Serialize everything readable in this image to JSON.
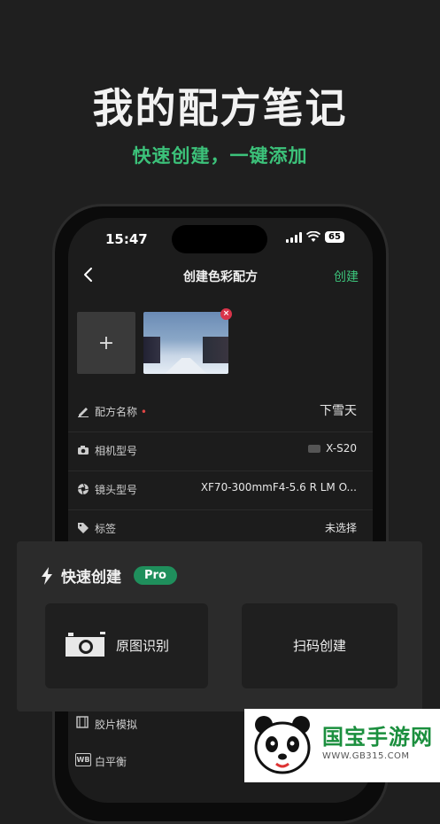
{
  "promo": {
    "headline": "我的配方笔记",
    "subline": "快速创建，一键添加"
  },
  "status_bar": {
    "time": "15:47",
    "battery": "65"
  },
  "nav": {
    "title": "创建色彩配方",
    "create_label": "创建"
  },
  "photos": {
    "add_symbol": "+",
    "remove_symbol": "×"
  },
  "form": {
    "recipe_name": {
      "label": "配方名称",
      "required_mark": "•",
      "value": "下雪天"
    },
    "camera_model": {
      "label": "相机型号",
      "value": "X-S20"
    },
    "lens_model": {
      "label": "镜头型号",
      "value": "XF70-300mmF4-5.6 R LM O..."
    },
    "tags": {
      "label": "标签",
      "value": "未选择"
    },
    "film_sim": {
      "label": "胶片模拟"
    },
    "white_balance": {
      "label": "白平衡",
      "icon_text": "WB"
    }
  },
  "quick_create": {
    "title": "快速创建",
    "badge": "Pro",
    "options": [
      {
        "label": "原图识别",
        "icon": "camera-icon"
      },
      {
        "label": "扫码创建",
        "icon": "none"
      }
    ]
  },
  "watermark": {
    "name": "国宝手游网",
    "url": "WWW.GB315.COM"
  },
  "colors": {
    "accent_green": "#3cc27a",
    "pro_badge": "#1f8f5c",
    "required_red": "#e04545",
    "background": "#1f1f1f"
  }
}
